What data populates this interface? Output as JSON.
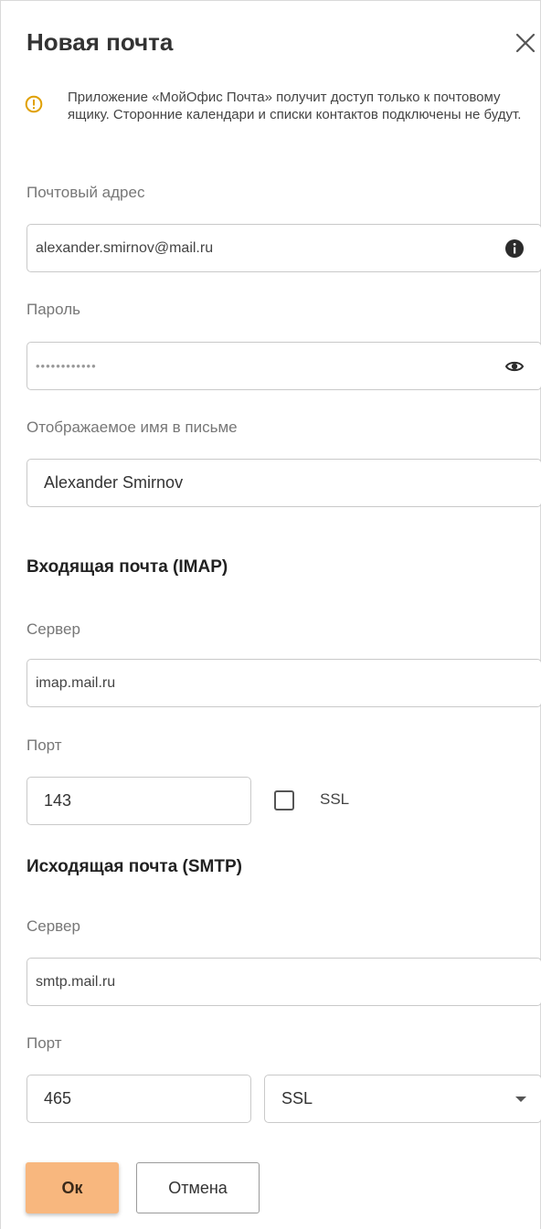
{
  "header": {
    "title": "Новая почта"
  },
  "notice": {
    "text": "Приложение «МойОфис Почта» получит доступ только к почтовому ящику. Сторонние календари и списки контактов подключены не будут."
  },
  "account": {
    "email_label": "Почтовый адрес",
    "email_value": "alexander.smirnov@mail.ru",
    "password_label": "Пароль",
    "password_value": "••••••••••••",
    "display_name_label": "Отображаемое имя в письме",
    "display_name_value": "Alexander Smirnov"
  },
  "incoming": {
    "heading": "Входящая почта (IMAP)",
    "server_label": "Сервер",
    "server_value": "imap.mail.ru",
    "port_label": "Порт",
    "port_value": "143",
    "ssl_label": "SSL",
    "ssl_checked": false
  },
  "outgoing": {
    "heading": "Исходящая почта (SMTP)",
    "server_label": "Сервер",
    "server_value": "smtp.mail.ru",
    "port_label": "Порт",
    "port_value": "465",
    "security_value": "SSL"
  },
  "buttons": {
    "ok": "Ок",
    "cancel": "Отмена"
  },
  "icons": {
    "close": "close-icon",
    "notice": "warning-circle-icon",
    "email_info": "info-icon",
    "password_toggle": "eye-icon",
    "dropdown": "chevron-down-icon"
  },
  "colors": {
    "accent": "#f8b77e",
    "warning": "#e0a000"
  }
}
